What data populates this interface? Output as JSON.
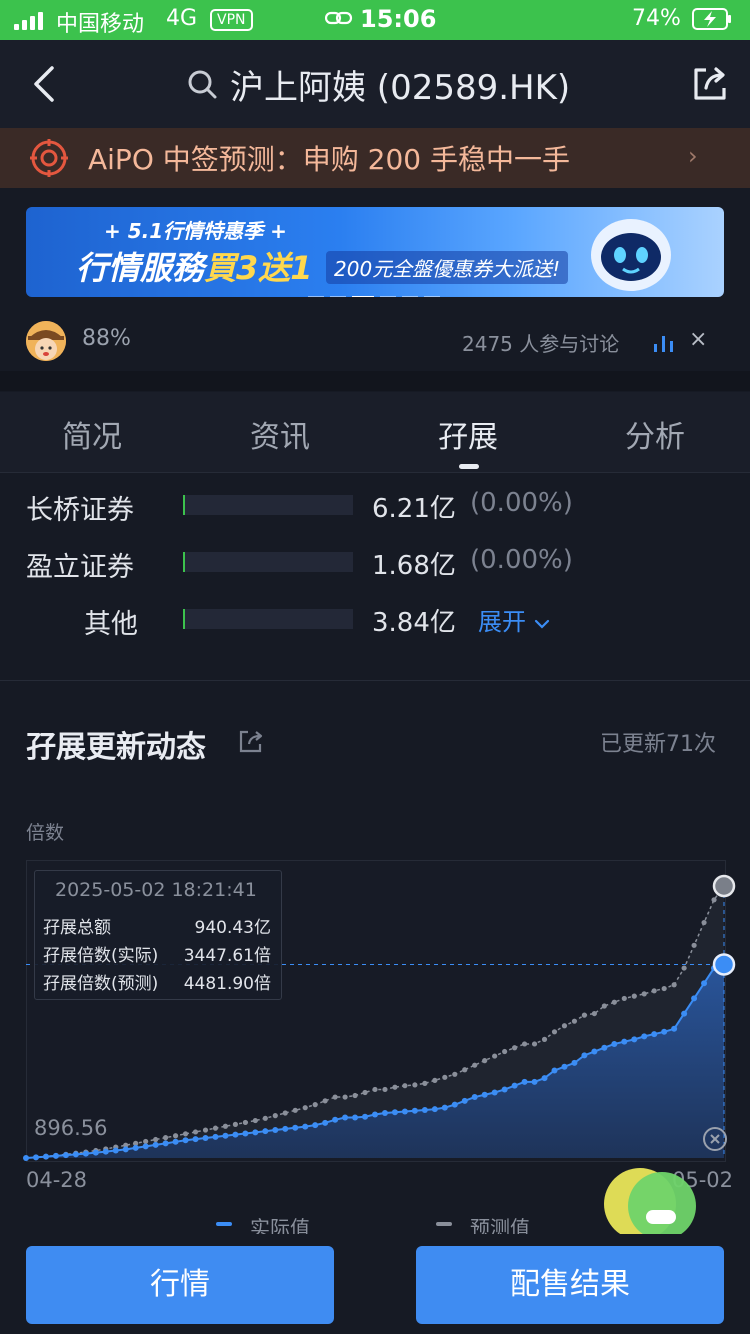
{
  "status_bar": {
    "carrier": "中国移动",
    "network": "4G",
    "vpn": "VPN",
    "time": "15:06",
    "battery": "74%"
  },
  "nav": {
    "title": "沪上阿姨 (02589.HK)",
    "icons": [
      "back-icon",
      "search-icon",
      "share-icon"
    ]
  },
  "aipo": {
    "text": "AiPO 中签预测：申购 200 手稳中一手",
    "arrow": "›"
  },
  "ad": {
    "top": "+ 5.1行情特惠季 +",
    "main_prefix": "行情服務",
    "main_highlight": "買3送1",
    "sub": "200元全盤優惠券大派送!"
  },
  "discussion": {
    "percent": "88%",
    "count_text": "2475 人参与讨论",
    "close": "×"
  },
  "tabs": [
    {
      "label": "简况",
      "active": false
    },
    {
      "label": "资讯",
      "active": false
    },
    {
      "label": "孖展",
      "active": true
    },
    {
      "label": "分析",
      "active": false
    }
  ],
  "brokers": [
    {
      "name": "长桥证券",
      "amount": "6.21亿",
      "pct": "(0.00%)",
      "fill": 0.012
    },
    {
      "name": "盈立证券",
      "amount": "1.68亿",
      "pct": "(0.00%)",
      "fill": 0.012
    },
    {
      "name": "其他",
      "amount": "3.84亿",
      "fill": 0.012
    }
  ],
  "expand_label": "展开",
  "dynamics": {
    "title": "孖展更新动态",
    "updated": "已更新71次",
    "y_label": "倍数"
  },
  "tooltip": {
    "time": "2025-05-02 18:21:41",
    "rows": [
      {
        "label": "孖展总额",
        "value": "940.43亿"
      },
      {
        "label": "孖展倍数(实际)",
        "value": "3447.61倍"
      },
      {
        "label": "孖展倍数(预测)",
        "value": "4481.90倍"
      }
    ]
  },
  "chart_data": {
    "type": "line",
    "x_start": "04-28",
    "x_end": "05-02",
    "y_min_label": "896.56",
    "ylim": [
      896.56,
      4481.9
    ],
    "series": [
      {
        "name": "实际值",
        "color": "#3b8df5",
        "values": [
          896.6,
          905,
          915,
          925,
          935,
          945,
          955,
          968,
          980,
          995,
          1010,
          1030,
          1050,
          1070,
          1090,
          1110,
          1130,
          1145,
          1160,
          1175,
          1190,
          1205,
          1220,
          1235,
          1250,
          1265,
          1280,
          1295,
          1310,
          1330,
          1360,
          1400,
          1430,
          1430,
          1440,
          1470,
          1490,
          1500,
          1510,
          1520,
          1530,
          1540,
          1560,
          1600,
          1650,
          1700,
          1730,
          1760,
          1800,
          1850,
          1900,
          1900,
          1950,
          2050,
          2100,
          2150,
          2250,
          2300,
          2350,
          2400,
          2430,
          2460,
          2500,
          2530,
          2560,
          2600,
          2800,
          3000,
          3200,
          3400,
          3447.61
        ]
      },
      {
        "name": "预测值",
        "color": "#8a8f9a",
        "values": [
          896.6,
          905,
          918,
          930,
          945,
          960,
          975,
          995,
          1015,
          1040,
          1065,
          1090,
          1115,
          1140,
          1165,
          1190,
          1215,
          1240,
          1265,
          1290,
          1315,
          1340,
          1365,
          1390,
          1420,
          1455,
          1490,
          1525,
          1560,
          1600,
          1650,
          1700,
          1700,
          1720,
          1760,
          1800,
          1800,
          1830,
          1850,
          1860,
          1880,
          1920,
          1960,
          2000,
          2060,
          2120,
          2180,
          2240,
          2300,
          2350,
          2400,
          2400,
          2460,
          2560,
          2640,
          2700,
          2780,
          2800,
          2900,
          2950,
          3000,
          3030,
          3060,
          3100,
          3130,
          3180,
          3400,
          3700,
          4000,
          4300,
          4481.9
        ]
      }
    ]
  },
  "legend": [
    {
      "label": "实际值",
      "color": "#3b8df5"
    },
    {
      "label": "预测值",
      "color": "#8a8f9a"
    }
  ],
  "bottom": {
    "left_button": "行情",
    "right_button": "配售结果"
  }
}
